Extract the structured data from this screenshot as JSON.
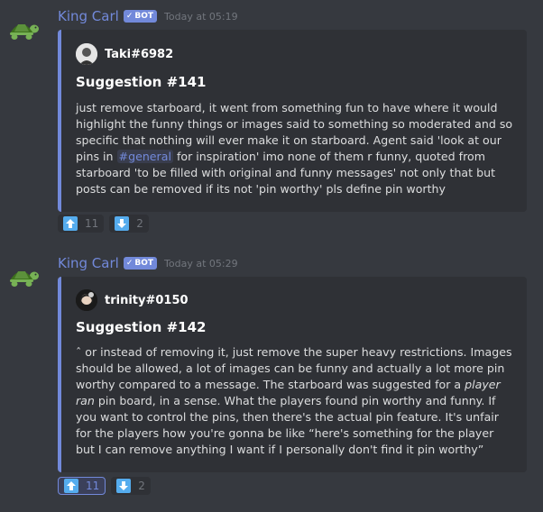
{
  "messages": [
    {
      "username": "King Carl",
      "bot_tag": "BOT",
      "check": "✓",
      "timestamp": "Today at 05:19",
      "embed": {
        "author": "Taki#6982",
        "title": "Suggestion #141",
        "desc_part1": "just remove starboard, it went from something fun to have where it would highlight the funny things or images said to something so moderated and so specific that nothing will ever make it on starboard. Agent said 'look at our pins in ",
        "mention": "#general",
        "desc_part2": " for inspiration' imo none of them r funny, quoted from starboard 'to be filled with original and funny messages' not only that but posts can be removed if its not 'pin worthy' pls define pin worthy"
      },
      "reactions": [
        {
          "emoji": "arrow-up",
          "count": "11"
        },
        {
          "emoji": "arrow-down",
          "count": "2"
        }
      ]
    },
    {
      "username": "King Carl",
      "bot_tag": "BOT",
      "check": "✓",
      "timestamp": "Today at 05:29",
      "embed": {
        "author": "trinity#0150",
        "title": "Suggestion #142",
        "desc_part1": "ˆ or instead of removing it, just remove the super heavy restrictions. Images should be allowed, a lot of images can be funny and actually a lot more pin worthy compared to a message. The starboard was suggested for a ",
        "italic": "player ran",
        "desc_part2": " pin board, in a sense. What the players found pin worthy and funny. If you want to control the pins, then there's the actual pin feature. It's unfair for the players how you're gonna be like “here's something for the player but I can remove anything I want if I personally don't find it pin worthy”"
      },
      "reactions": [
        {
          "emoji": "arrow-up",
          "count": "11"
        },
        {
          "emoji": "arrow-down",
          "count": "2"
        }
      ]
    }
  ],
  "colors": {
    "background": "#36393f",
    "embed_bg": "#2f3136",
    "accent": "#7289da",
    "text": "#dcddde",
    "muted": "#72767d"
  }
}
